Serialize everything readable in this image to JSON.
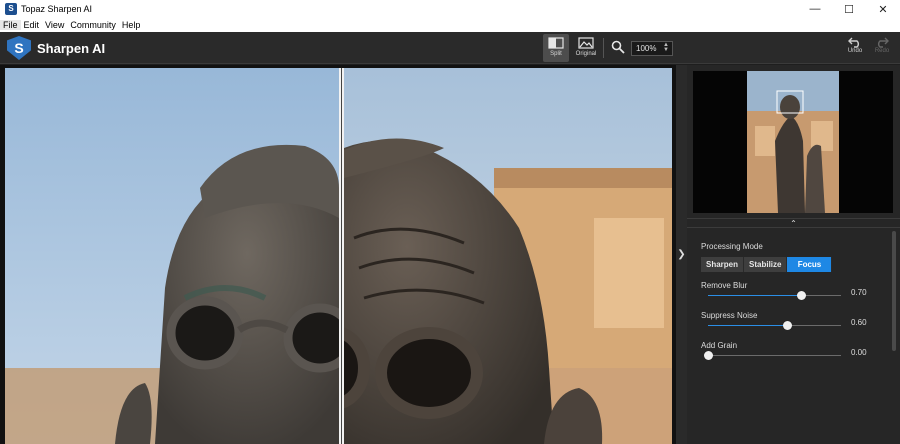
{
  "window": {
    "title": "Topaz Sharpen AI",
    "icon_letter": "S"
  },
  "menu": [
    "File",
    "Edit",
    "View",
    "Community",
    "Help"
  ],
  "header": {
    "brand": "Sharpen AI",
    "logo_letter": "S",
    "split_label": "Split",
    "original_label": "Original",
    "zoom_value": "100%",
    "undo_label": "Undo",
    "redo_label": "Redo"
  },
  "panel": {
    "processing_mode_label": "Processing Mode",
    "modes": [
      "Sharpen",
      "Stabilize",
      "Focus"
    ],
    "active_mode": "Focus",
    "sliders": [
      {
        "label": "Remove Blur",
        "value": "0.70",
        "fraction": 0.7
      },
      {
        "label": "Suppress Noise",
        "value": "0.60",
        "fraction": 0.6
      },
      {
        "label": "Add Grain",
        "value": "0.00",
        "fraction": 0.0
      }
    ]
  },
  "colors": {
    "accent": "#1e88e5",
    "header_bg": "#2a2a2a",
    "panel_bg": "#262626"
  },
  "icons": [
    "app-logo-icon",
    "split-view-icon",
    "original-view-icon",
    "zoom-icon",
    "undo-icon",
    "redo-icon",
    "expand-panel-icon",
    "collapse-panel-icon"
  ]
}
